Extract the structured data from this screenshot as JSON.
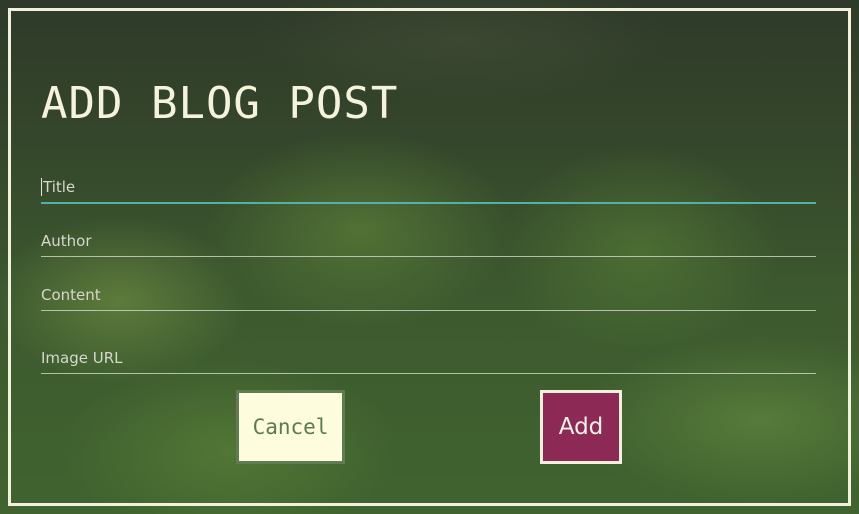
{
  "form": {
    "title": "ADD BLOG POST",
    "fields": [
      {
        "name": "title",
        "value": "",
        "placeholder": "Title",
        "focused": true
      },
      {
        "name": "author",
        "value": "",
        "placeholder": "Author"
      },
      {
        "name": "content",
        "value": "",
        "placeholder": "Content"
      },
      {
        "name": "image_url",
        "value": "",
        "placeholder": "Image URL"
      }
    ],
    "cancel_label": "Cancel",
    "add_label": "Add"
  },
  "colors": {
    "frame_border": "#f3f1dc",
    "focus_underline": "#4fb3a9",
    "cancel_bg": "#fdfcdc",
    "cancel_border": "#5e7d52",
    "add_bg": "#8c2a55"
  }
}
